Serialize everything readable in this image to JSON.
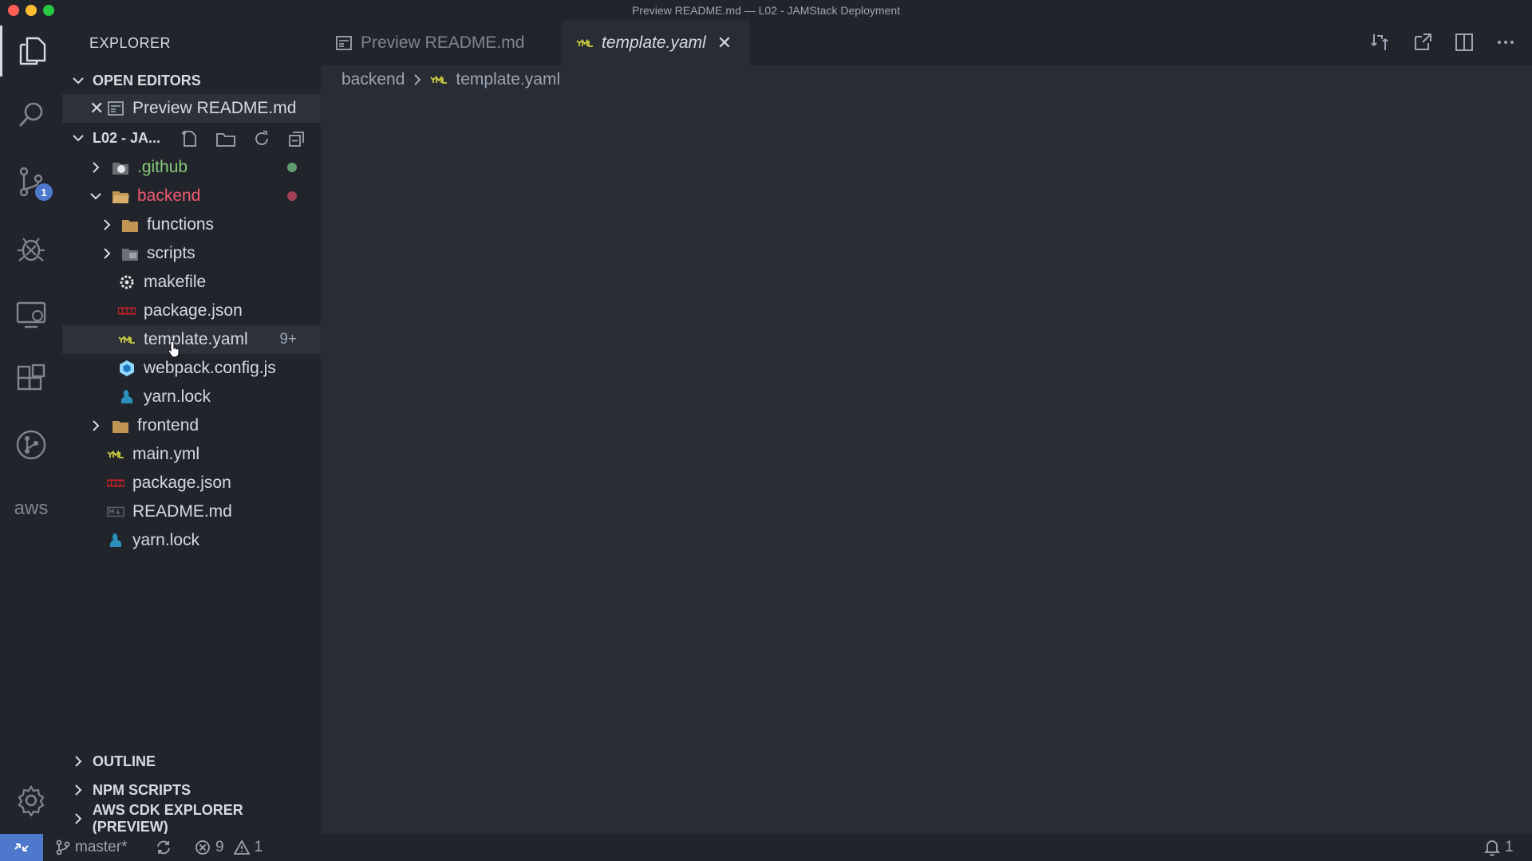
{
  "window": {
    "title": "Preview README.md — L02 - JAMStack Deployment"
  },
  "activity_bar": {
    "items": [
      {
        "name": "explorer-icon"
      },
      {
        "name": "search-icon"
      },
      {
        "name": "source-control-icon",
        "badge": "1"
      },
      {
        "name": "debug-icon"
      },
      {
        "name": "remote-explorer-icon"
      },
      {
        "name": "extensions-icon"
      },
      {
        "name": "git-graph-icon"
      },
      {
        "name": "aws-icon",
        "text": "aws"
      },
      {
        "name": "settings-gear-icon"
      }
    ]
  },
  "sidebar": {
    "title": "EXPLORER",
    "open_editors": {
      "label": "OPEN EDITORS",
      "items": [
        {
          "label": "Preview README.md"
        }
      ]
    },
    "workspace": {
      "label": "L02 - JA...",
      "tree": [
        {
          "label": ".github",
          "color": "#89ca78",
          "status_dot": "#5f9e6e"
        },
        {
          "label": "backend",
          "color": "#ef596f",
          "status_dot": "#a34256"
        },
        {
          "label": "functions"
        },
        {
          "label": "scripts"
        },
        {
          "label": "makefile"
        },
        {
          "label": "package.json"
        },
        {
          "label": "template.yaml",
          "decoration": "9+"
        },
        {
          "label": "webpack.config.js"
        },
        {
          "label": "yarn.lock"
        },
        {
          "label": "frontend"
        },
        {
          "label": "main.yml"
        },
        {
          "label": "package.json"
        },
        {
          "label": "README.md"
        },
        {
          "label": "yarn.lock"
        }
      ]
    },
    "panels": [
      {
        "label": "OUTLINE"
      },
      {
        "label": "NPM SCRIPTS"
      },
      {
        "label": "AWS CDK EXPLORER (PREVIEW)"
      }
    ]
  },
  "editor": {
    "tabs": [
      {
        "label": "Preview README.md",
        "active": false
      },
      {
        "label": "template.yaml",
        "active": true
      }
    ],
    "breadcrumb": {
      "folder": "backend",
      "file": "template.yaml"
    }
  },
  "status_bar": {
    "branch": "master*",
    "errors": "9",
    "warnings": "1",
    "notifications": "1"
  },
  "colors": {
    "accent": "#4d78cc",
    "yaml_icon": "#cbcb41",
    "folder": "#c09553",
    "json_icon": "#e06c75",
    "webpack": "#8ed6fb",
    "yarn": "#2c8ebb"
  }
}
